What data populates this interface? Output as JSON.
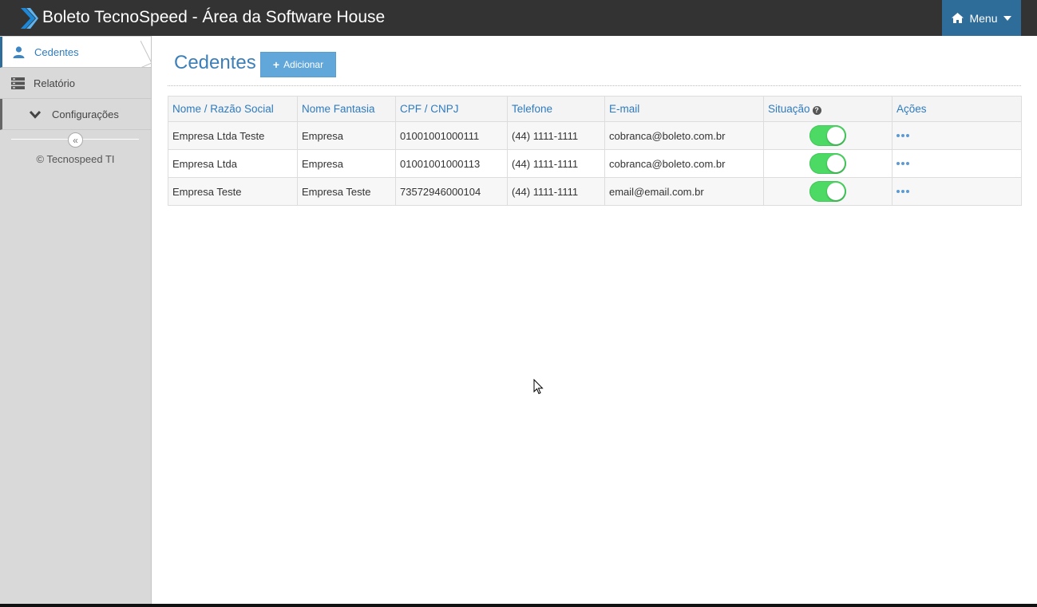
{
  "app": {
    "title": "Boleto TecnoSpeed - Área da Software House",
    "menu_label": "Menu"
  },
  "sidebar": {
    "items": [
      {
        "label": "Cedentes",
        "icon": "user-icon"
      },
      {
        "label": "Relatório",
        "icon": "report-icon"
      },
      {
        "label": "Configurações",
        "icon": "chevron-down-icon"
      }
    ],
    "collapse_label": "«",
    "copyright": "© Tecnospeed TI"
  },
  "main": {
    "title": "Cedentes",
    "add_label": "Adicionar",
    "table": {
      "headers": [
        "Nome / Razão Social",
        "Nome Fantasia",
        "CPF / CNPJ",
        "Telefone",
        "E-mail",
        "Situação",
        "Ações"
      ],
      "rows": [
        {
          "nome": "Empresa Ltda Teste",
          "fantasia": "Empresa",
          "cpf": "01001001000111",
          "telefone": "(44) 1111-1111",
          "email": "cobranca@boleto.com.br",
          "ativo": true
        },
        {
          "nome": "Empresa Ltda",
          "fantasia": "Empresa",
          "cpf": "01001001000113",
          "telefone": "(44) 1111-1111",
          "email": "cobranca@boleto.com.br",
          "ativo": true
        },
        {
          "nome": "Empresa Teste",
          "fantasia": "Empresa Teste",
          "cpf": "73572946000104",
          "telefone": "(44) 1111-1111",
          "email": "email@email.com.br",
          "ativo": true
        }
      ]
    }
  },
  "colors": {
    "topbar": "#333333",
    "accent": "#2e6c9a",
    "link": "#2e7bbf",
    "toggle_on": "#4cd964",
    "add_button": "#62a7da"
  }
}
